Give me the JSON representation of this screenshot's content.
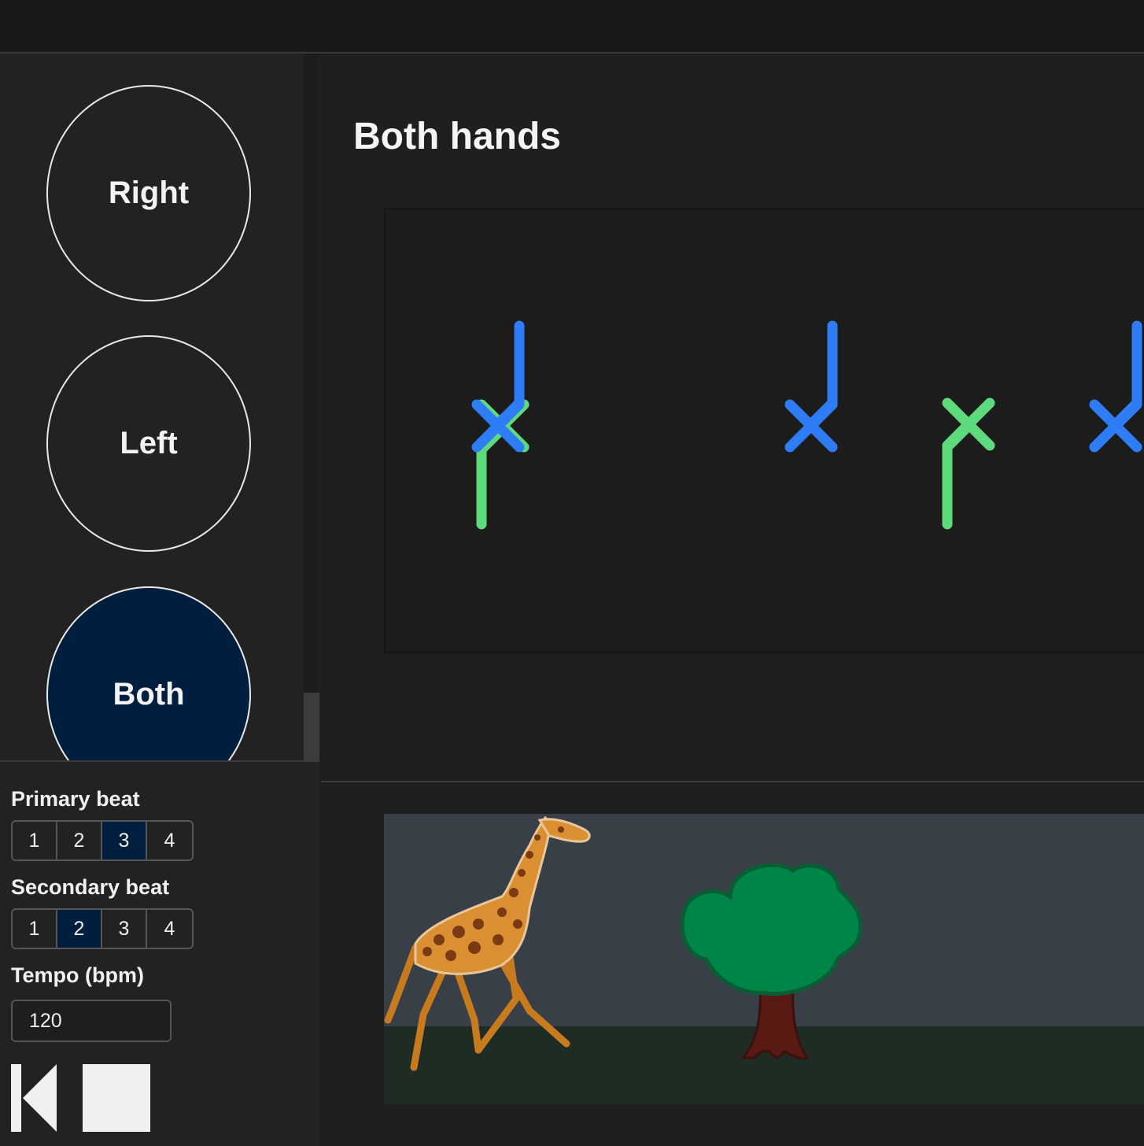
{
  "hand_buttons": [
    {
      "label": "Right",
      "active": false
    },
    {
      "label": "Left",
      "active": false
    },
    {
      "label": "Both",
      "active": true
    }
  ],
  "main": {
    "title": "Both hands"
  },
  "controls": {
    "primary_beat": {
      "label": "Primary beat",
      "options": [
        "1",
        "2",
        "3",
        "4"
      ],
      "selected": "3"
    },
    "secondary_beat": {
      "label": "Secondary beat",
      "options": [
        "1",
        "2",
        "3",
        "4"
      ],
      "selected": "2"
    },
    "tempo": {
      "label": "Tempo (bpm)",
      "value": "120"
    },
    "icons": [
      "skip-back-icon",
      "stop-icon"
    ]
  },
  "colors": {
    "right_hand": "#2f7df6",
    "left_hand": "#5ddb7c",
    "selected": "#001f3f",
    "sky": "#383f46",
    "ground": "#1e2c24",
    "tree_crown": "#008548",
    "tree_trunk": "#5a1a14"
  },
  "scene": {
    "animal": "giraffe",
    "object": "tree"
  }
}
